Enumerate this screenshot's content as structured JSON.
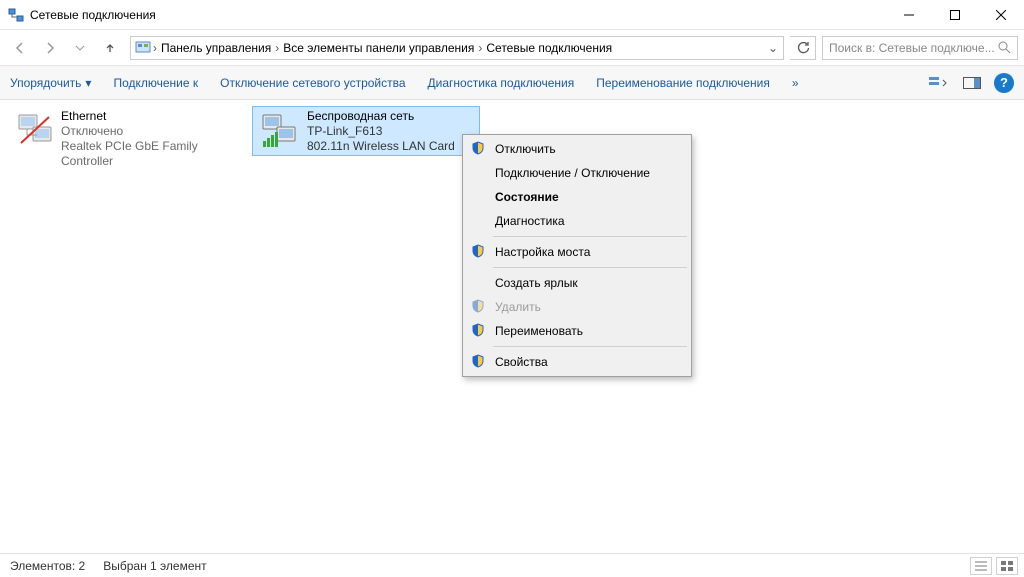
{
  "window": {
    "title": "Сетевые подключения"
  },
  "breadcrumb": {
    "item1": "Панель управления",
    "item2": "Все элементы панели управления",
    "item3": "Сетевые подключения"
  },
  "search": {
    "placeholder": "Поиск в: Сетевые подключе..."
  },
  "cmdbar": {
    "organize": "Упорядочить",
    "connect": "Подключение к",
    "disable": "Отключение сетевого устройства",
    "diagnose": "Диагностика подключения",
    "rename": "Переименование подключения",
    "more": "»"
  },
  "connections": {
    "eth": {
      "name": "Ethernet",
      "status": "Отключено",
      "device": "Realtek PCIe GbE Family Controller"
    },
    "wifi": {
      "name": "Беспроводная сеть",
      "status": "TP-Link_F613",
      "device": "802.11n Wireless LAN Card"
    }
  },
  "context": {
    "disconnect": "Отключить",
    "toggle": "Подключение / Отключение",
    "status": "Состояние",
    "diagnostics": "Диагностика",
    "bridge": "Настройка моста",
    "shortcut": "Создать ярлык",
    "delete": "Удалить",
    "rename": "Переименовать",
    "properties": "Свойства"
  },
  "statusbar": {
    "count": "Элементов: 2",
    "selected": "Выбран 1 элемент"
  }
}
